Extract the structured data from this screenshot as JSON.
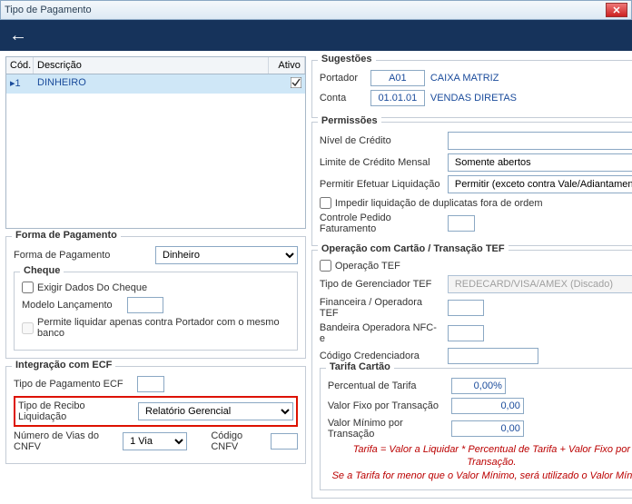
{
  "window": {
    "title": "Tipo de Pagamento"
  },
  "grid": {
    "headers": {
      "cod": "Cód.",
      "desc": "Descrição",
      "ativo": "Ativo"
    },
    "rows": [
      {
        "cod": "1",
        "desc": "DINHEIRO",
        "ativo": true
      }
    ]
  },
  "forma_pagamento": {
    "legend": "Forma de Pagamento",
    "forma_label": "Forma de Pagamento",
    "forma_value": "Dinheiro",
    "cheque": {
      "legend": "Cheque",
      "exigir_label": "Exigir Dados Do Cheque",
      "modelo_label": "Modelo Lançamento",
      "permite_label": "Permite liquidar apenas contra Portador com o mesmo banco"
    }
  },
  "ecf": {
    "legend": "Integração com ECF",
    "tipo_pag_label": "Tipo de Pagamento ECF",
    "tipo_recibo_label": "Tipo de Recibo Liquidação",
    "tipo_recibo_value": "Relatório Gerencial",
    "num_vias_label": "Número de Vias do CNFV",
    "num_vias_value": "1 Via",
    "codigo_cnfv_label": "Código CNFV"
  },
  "sugestoes": {
    "legend": "Sugestões",
    "portador_label": "Portador",
    "portador_code": "A01",
    "portador_desc": "CAIXA MATRIZ",
    "conta_label": "Conta",
    "conta_code": "01.01.01",
    "conta_desc": "VENDAS DIRETAS"
  },
  "permissoes": {
    "legend": "Permissões",
    "nivel_label": "Nível de Crédito",
    "limite_label": "Limite de Crédito Mensal",
    "limite_value": "Somente abertos",
    "permitir_label": "Permitir Efetuar Liquidação",
    "permitir_value": "Permitir (exceto contra Vale/Adiantamento)",
    "impedir_label": "Impedir liquidação de duplicatas fora de ordem",
    "controle_label": "Controle Pedido Faturamento"
  },
  "cartao": {
    "legend": "Operação com Cartão / Transação TEF",
    "operacao_label": "Operação TEF",
    "gerenciador_label": "Tipo de Gerenciador TEF",
    "gerenciador_value": "REDECARD/VISA/AMEX (Discado)",
    "financeira_label": "Financeira / Operadora TEF",
    "bandeira_label": "Bandeira Operadora NFC-e",
    "codigo_cred_label": "Código Credenciadora",
    "tarifa": {
      "legend": "Tarifa Cartão",
      "percentual_label": "Percentual de Tarifa",
      "percentual_value": "0,00%",
      "valor_fixo_label": "Valor Fixo por Transação",
      "valor_fixo_value": "0,00",
      "valor_min_label": "Valor Mínimo por Transação",
      "valor_min_value": "0,00",
      "note1": "Tarifa = Valor a Liquidar * Percentual de Tarifa + Valor Fixo por Transação.",
      "note2": "Se a Tarifa for menor que o Valor Mínimo, será utilizado o Valor Mínimo."
    }
  }
}
